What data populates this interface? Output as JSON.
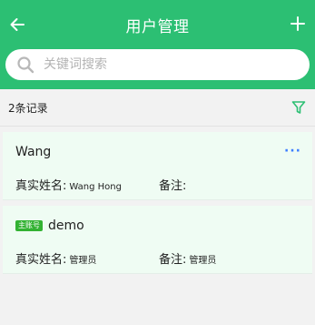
{
  "header": {
    "title": "用户管理",
    "back_icon": "arrow-left-icon",
    "add_icon": "plus-icon",
    "color": "#2cbf73"
  },
  "search": {
    "placeholder": "关键词搜索",
    "value": "",
    "icon": "search-icon"
  },
  "summary": {
    "count_text": "2条记录",
    "filter_icon": "filter-icon",
    "filter_color": "#2cbf73"
  },
  "users": [
    {
      "name": "Wang",
      "badge": "",
      "has_more": true,
      "more_label": "···",
      "real_name_label": "真实姓名:",
      "real_name": "Wang Hong",
      "note_label": "备注:",
      "note": ""
    },
    {
      "name": "demo",
      "badge": "主账号",
      "has_more": false,
      "more_label": "",
      "real_name_label": "真实姓名:",
      "real_name": "管理员",
      "note_label": "备注:",
      "note": "管理员"
    }
  ],
  "colors": {
    "card_bg": "#effcf3",
    "badge_bg": "#33b233",
    "more_color": "#3d7eff"
  }
}
